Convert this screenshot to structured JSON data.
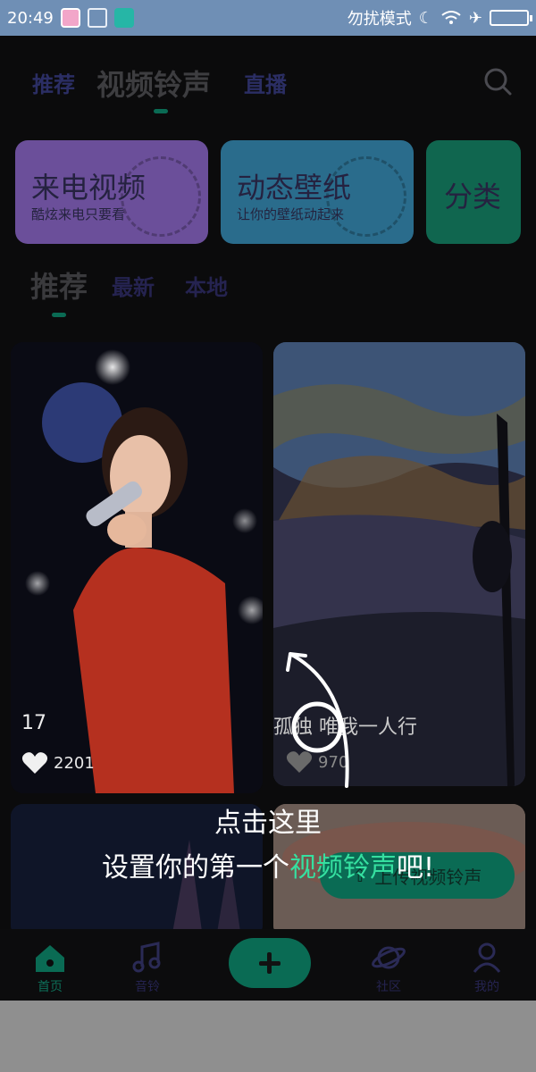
{
  "status_bar": {
    "time": "20:49",
    "right_text": "勿扰模式",
    "icons": [
      "app-icon",
      "bag-icon",
      "usb-icon",
      "moon-icon",
      "wifi-icon",
      "airplane-icon",
      "battery-icon"
    ]
  },
  "top_tabs": [
    {
      "label": "推荐",
      "active": false
    },
    {
      "label": "视频铃声",
      "active": true
    },
    {
      "label": "直播",
      "active": false
    }
  ],
  "feature_cards": [
    {
      "title": "来电视频",
      "subtitle": "酷炫来电只要看",
      "color": "#6b4f9a"
    },
    {
      "title": "动态壁纸",
      "subtitle": "让你的壁纸动起来",
      "color": "#2a6c8c"
    },
    {
      "title": "分类",
      "subtitle": "",
      "color": "#10664f"
    }
  ],
  "sub_tabs": [
    {
      "label": "推荐",
      "active": true
    },
    {
      "label": "最新",
      "active": false
    },
    {
      "label": "本地",
      "active": false
    }
  ],
  "videos": [
    {
      "title": "17",
      "likes": "2201"
    },
    {
      "title": "孤独 唯我一人行",
      "likes": "970"
    }
  ],
  "upload_button": "上传视频铃声",
  "hint": {
    "line1": "点击这里",
    "line2_prefix": "设置你的第一个",
    "line2_highlight": "视频铃声",
    "line2_suffix": "吧!"
  },
  "bottom_nav": [
    {
      "label": "首页",
      "icon": "home-icon",
      "active": true
    },
    {
      "label": "音铃",
      "icon": "music-icon",
      "active": false
    },
    {
      "label": "社区",
      "icon": "planet-icon",
      "active": false
    },
    {
      "label": "我的",
      "icon": "user-icon",
      "active": false
    }
  ],
  "colors": {
    "accent": "#0a6b54",
    "highlight": "#35e0a0",
    "status_bar": "#6f8fb5"
  }
}
